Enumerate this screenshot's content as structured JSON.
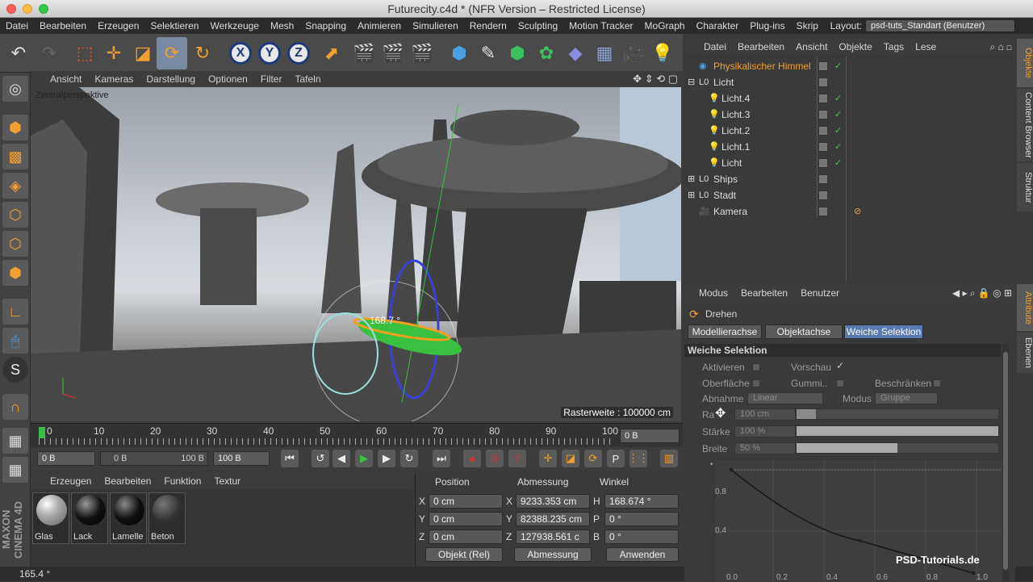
{
  "window": {
    "title": "Futurecity.c4d * (NFR Version – Restricted License)"
  },
  "menubar": {
    "items": [
      "Datei",
      "Bearbeiten",
      "Erzeugen",
      "Selektieren",
      "Werkzeuge",
      "Mesh",
      "Snapping",
      "Animieren",
      "Simulieren",
      "Rendern",
      "Sculpting",
      "Motion Tracker",
      "MoGraph",
      "Charakter",
      "Plug-ins",
      "Skrip"
    ],
    "layout_label": "Layout:",
    "layout_value": "psd-tuts_Standart (Benutzer)"
  },
  "toolbar": {
    "x_label": "X",
    "y_label": "Y",
    "z_label": "Z"
  },
  "viewport": {
    "menu": [
      "Ansicht",
      "Kameras",
      "Darstellung",
      "Optionen",
      "Filter",
      "Tafeln"
    ],
    "camera_label": "Zentralperspektive",
    "angle_readout": "168.7 °",
    "grid_info": "Rasterweite : 100000 cm"
  },
  "timeline": {
    "ticks": [
      "0",
      "10",
      "20",
      "30",
      "40",
      "50",
      "60",
      "70",
      "80",
      "90",
      "100"
    ],
    "current_frame": "0 B",
    "start": "0 B",
    "range_start": "0 B",
    "range_end": "100 B",
    "end": "100 B"
  },
  "materials": {
    "menu": [
      "Erzeugen",
      "Bearbeiten",
      "Funktion",
      "Textur"
    ],
    "items": [
      "Glas",
      "Lack",
      "Lamelle",
      "Beton"
    ]
  },
  "coordinates": {
    "headers": [
      "Position",
      "Abmessung",
      "Winkel"
    ],
    "rows": [
      {
        "axis": "X",
        "pos": "0 cm",
        "dim_axis": "X",
        "dim": "9233.353 cm",
        "ang_axis": "H",
        "ang": "168.674 °"
      },
      {
        "axis": "Y",
        "pos": "0 cm",
        "dim_axis": "Y",
        "dim": "82388.235 cm",
        "ang_axis": "P",
        "ang": "0 °"
      },
      {
        "axis": "Z",
        "pos": "0 cm",
        "dim_axis": "Z",
        "dim": "127938.561 c",
        "ang_axis": "B",
        "ang": "0 °"
      }
    ],
    "mode_select": "Objekt (Rel)",
    "size_select": "Abmessung",
    "apply_button": "Anwenden"
  },
  "status": {
    "text": "165.4 °"
  },
  "object_manager": {
    "menu": [
      "Datei",
      "Bearbeiten",
      "Ansicht",
      "Objekte",
      "Tags",
      "Lese"
    ],
    "objects": [
      {
        "name": "Physikalischer Himmel",
        "indent": 0,
        "highlight": true,
        "check": true
      },
      {
        "name": "Licht",
        "indent": 0,
        "highlight": false,
        "check": false
      },
      {
        "name": "Licht.4",
        "indent": 1,
        "highlight": false,
        "check": true
      },
      {
        "name": "Licht.3",
        "indent": 1,
        "highlight": false,
        "check": true
      },
      {
        "name": "Licht.2",
        "indent": 1,
        "highlight": false,
        "check": true
      },
      {
        "name": "Licht.1",
        "indent": 1,
        "highlight": false,
        "check": true
      },
      {
        "name": "Licht",
        "indent": 1,
        "highlight": false,
        "check": true
      },
      {
        "name": "Ships",
        "indent": 0,
        "highlight": false,
        "check": false
      },
      {
        "name": "Stadt",
        "indent": 0,
        "highlight": false,
        "check": false
      },
      {
        "name": "Kamera",
        "indent": 0,
        "highlight": false,
        "check": false
      }
    ],
    "side_tabs": [
      "Objekte",
      "Content Browser",
      "Struktur"
    ]
  },
  "attributes": {
    "menu": [
      "Modus",
      "Bearbeiten",
      "Benutzer"
    ],
    "tool_name": "Drehen",
    "tabs": [
      "Modellierachse",
      "Objektachse",
      "Weiche Selektion"
    ],
    "section_title": "Weiche Selektion",
    "aktivieren": "Aktivieren",
    "vorschau": "Vorschau",
    "oberflaeche": "Oberfläche",
    "gummi": "Gummi..",
    "beschraenken": "Beschränken",
    "abnahme_label": "Abnahme",
    "abnahme_value": "Linear",
    "modus_label": "Modus",
    "modus_value": "Gruppe",
    "radius_label": "Ra",
    "radius_value": "100 cm",
    "staerke_label": "Stärke",
    "staerke_value": "100 %",
    "staerke_fraction": 1.0,
    "breite_label": "Breite",
    "breite_value": "50 %",
    "breite_fraction": 0.5,
    "graph_y_ticks": [
      "0.8",
      "0.4"
    ],
    "graph_x_ticks": [
      "0.0",
      "0.2",
      "0.4",
      "0.6",
      "0.8",
      "1.0"
    ],
    "side_tabs": [
      "Attribute",
      "Ebenen"
    ]
  },
  "watermark": "PSD-Tutorials.de"
}
